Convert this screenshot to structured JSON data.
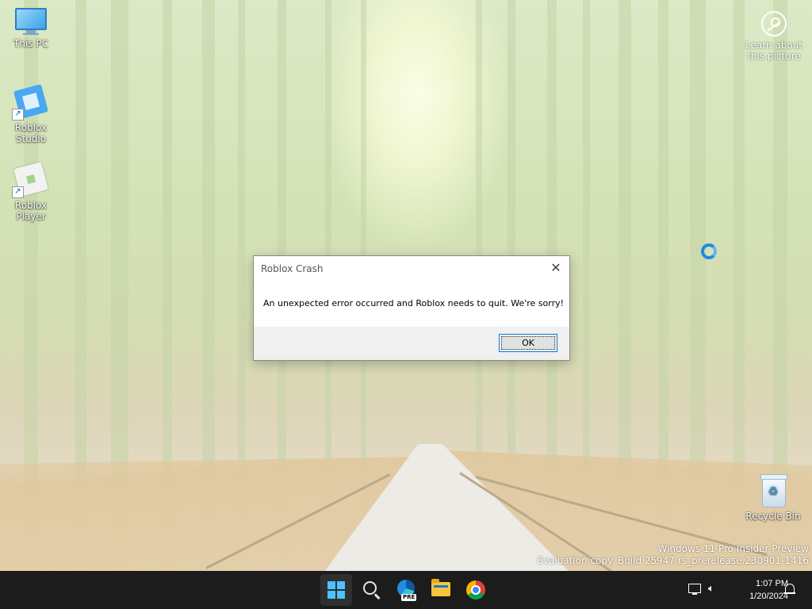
{
  "desktop": {
    "icons": [
      {
        "label": "This PC"
      },
      {
        "label": "Roblox Studio"
      },
      {
        "label": "Roblox Player"
      },
      {
        "label": "Recycle Bin"
      }
    ],
    "learn_about": {
      "line1": "Learn about",
      "line2": "this picture"
    },
    "watermark": {
      "line1": "Windows 11 Pro Insider Preview",
      "line2": "Evaluation copy. Build 25947.rs_prerelease.230901-1416"
    }
  },
  "dialog": {
    "title": "Roblox Crash",
    "close_glyph": "✕",
    "message": "An unexpected error occurred and Roblox needs to quit.  We're sorry!",
    "ok_label": "OK"
  },
  "taskbar": {
    "pinned": [
      "start-icon",
      "search-icon",
      "edge-preview-icon",
      "file-explorer-icon",
      "chrome-icon"
    ],
    "edge_badge": "PRE",
    "clock": {
      "time": "1:07 PM",
      "date": "1/20/2024"
    },
    "colors": {
      "start_accent": "#4cc2ff",
      "taskbar_bg": "#1c1c1c"
    }
  }
}
